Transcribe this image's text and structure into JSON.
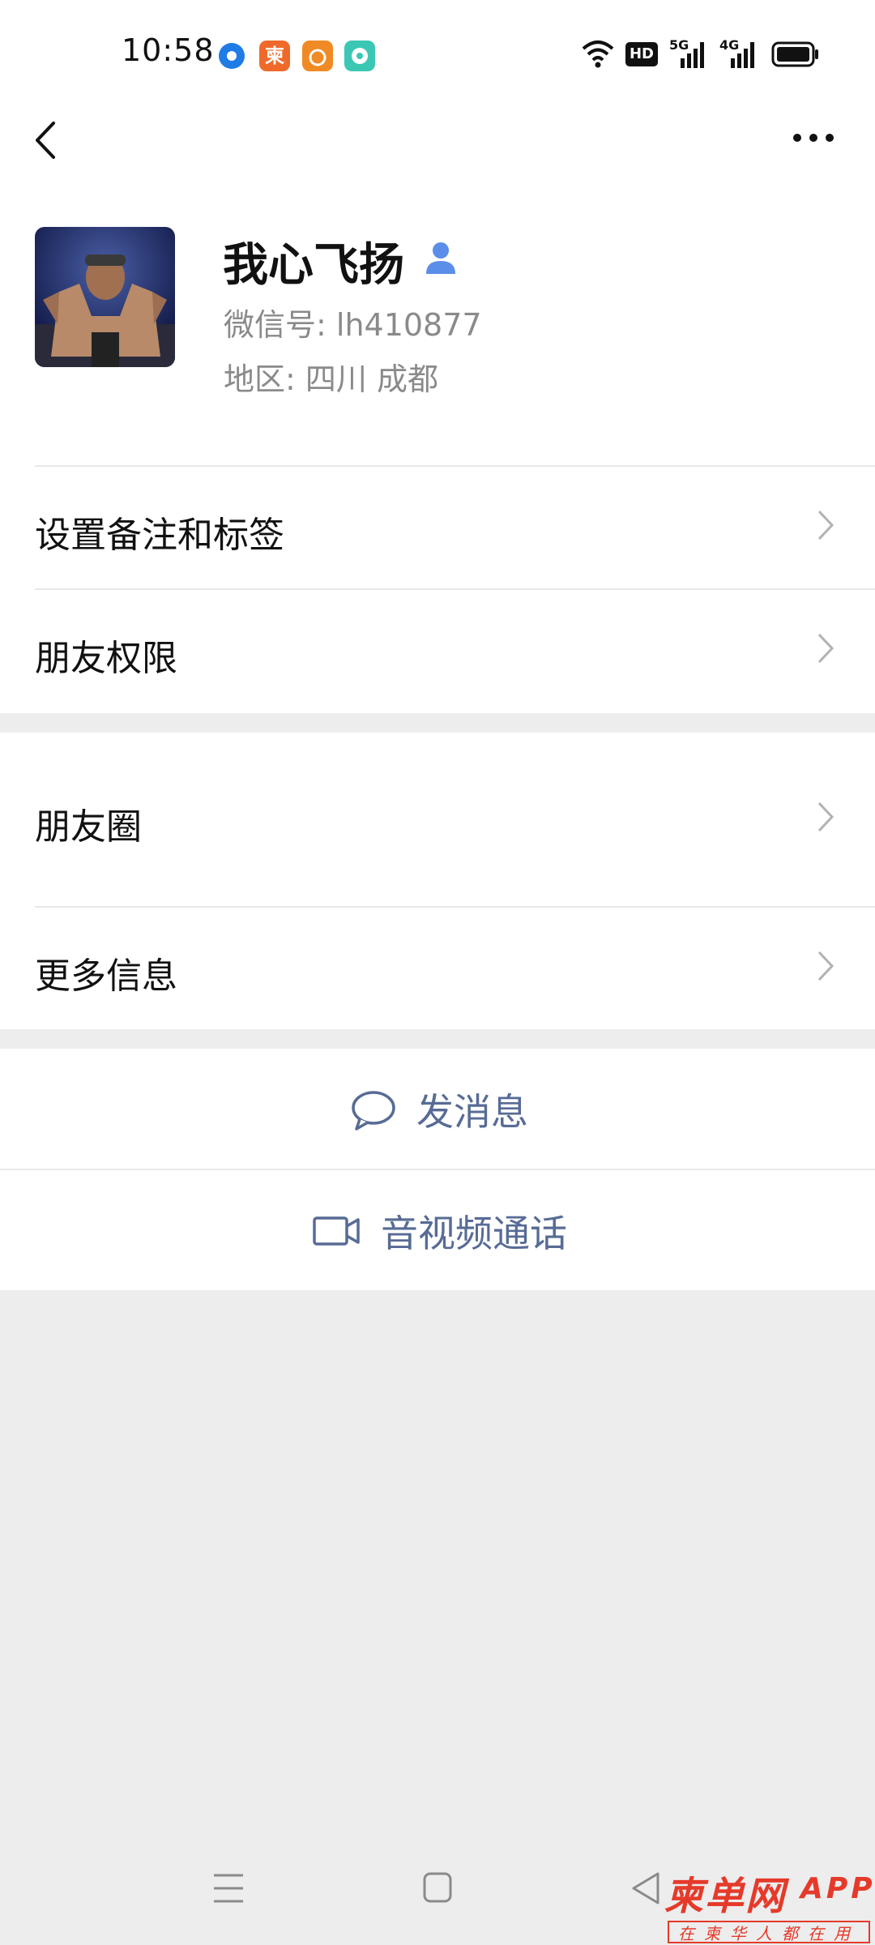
{
  "status_bar": {
    "time": "10:58",
    "notification_app_text": "柬",
    "indicators": [
      "wifi-icon",
      "hd-icon",
      "5g-signal-icon",
      "4g-signal-icon",
      "battery-icon"
    ],
    "hd_label": "HD",
    "net1": "5G",
    "net2": "4G"
  },
  "nav": {
    "back_icon": "chevron-left-icon",
    "more_icon": "more-dots-icon"
  },
  "profile": {
    "name": "我心飞扬",
    "wechat_id": "微信号:  lh410877",
    "region": "地区:  四川  成都"
  },
  "menu": {
    "remark": "设置备注和标签",
    "permissions": "朋友权限",
    "moments": "朋友圈",
    "more_info": "更多信息"
  },
  "actions": {
    "message": "发消息",
    "call": "音视频通话"
  },
  "watermark": {
    "title": "柬单网",
    "app": "APP",
    "slogan": "在柬华人都在用"
  },
  "colors": {
    "accent": "#576b95",
    "background": "#ededed",
    "watermark": "#e53a2a"
  }
}
